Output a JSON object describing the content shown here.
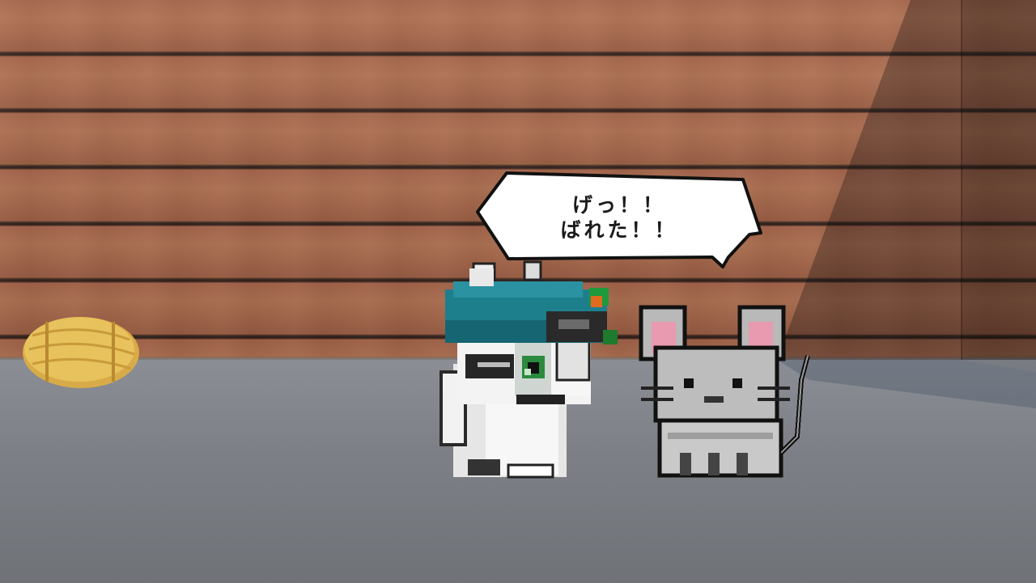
{
  "dialogue": {
    "line1": "げっ！！",
    "line2": "ばれた！！"
  },
  "colors": {
    "wall": "#a9694a",
    "floor": "#7d8187",
    "hay": "#e8c25c",
    "bubble": "#ffffff",
    "beret": "#1e7f8c"
  },
  "icons": [
    "hay-bale-icon",
    "cat-character-icon",
    "mouse-character-icon",
    "speech-bubble-icon"
  ]
}
